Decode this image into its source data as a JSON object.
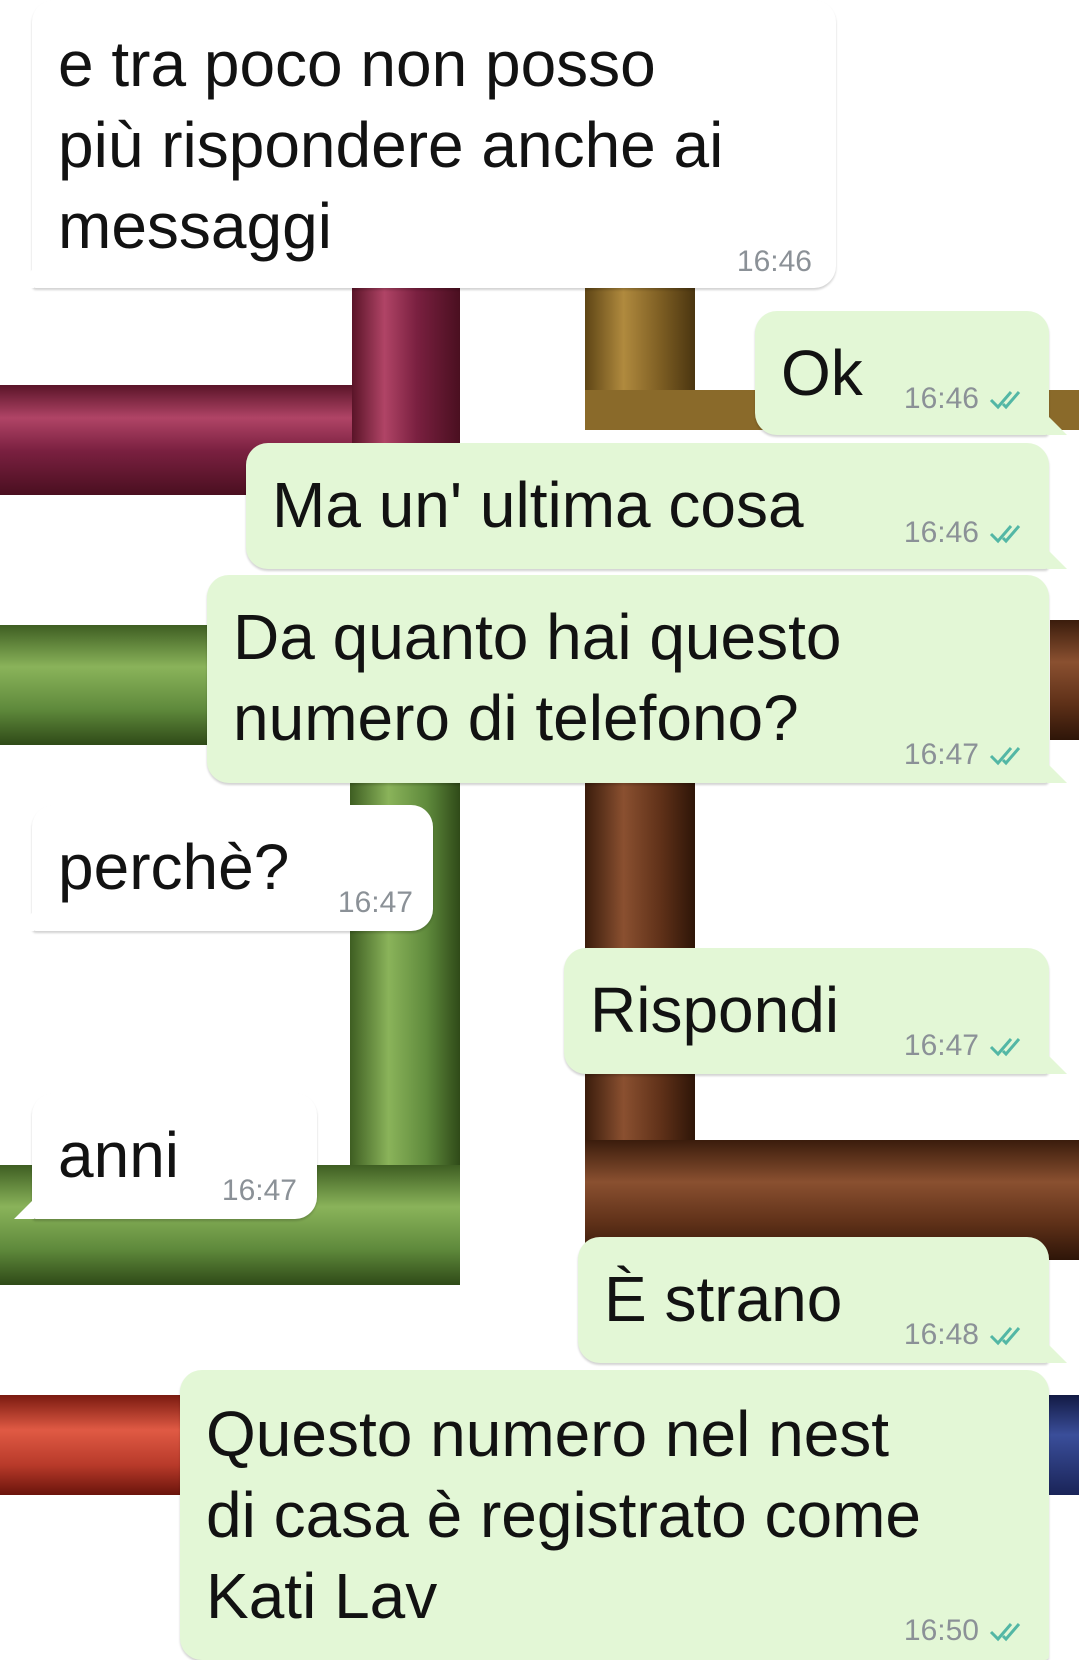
{
  "colors": {
    "incoming_bubble": "#ffffff",
    "outgoing_bubble": "#e3f7d6",
    "timestamp": "#8b9197",
    "read_ticks": "#53b7a5",
    "wallpaper_frames": [
      "#8e2b4b",
      "#8a6a2a",
      "#5f8a3c",
      "#6b3a20",
      "#c23a2c",
      "#2a3a7a"
    ]
  },
  "wallpaper": {
    "description_icon": "decorative-frames-wallpaper"
  },
  "messages": [
    {
      "id": "m1",
      "direction": "incoming",
      "text": "e tra poco non posso\npiù rispondere anche ai\nmessaggi",
      "time": "16:46"
    },
    {
      "id": "m2",
      "direction": "outgoing",
      "text": "Ok",
      "time": "16:46",
      "status_icon": "double-check-icon"
    },
    {
      "id": "m3",
      "direction": "outgoing",
      "text": "Ma un' ultima cosa",
      "time": "16:46",
      "status_icon": "double-check-icon"
    },
    {
      "id": "m4",
      "direction": "outgoing",
      "text": "Da quanto hai questo\nnumero di telefono?",
      "time": "16:47",
      "status_icon": "double-check-icon"
    },
    {
      "id": "m5",
      "direction": "incoming",
      "text": "perchè?",
      "time": "16:47"
    },
    {
      "id": "m6",
      "direction": "outgoing",
      "text": "Rispondi",
      "time": "16:47",
      "status_icon": "double-check-icon"
    },
    {
      "id": "m7",
      "direction": "incoming",
      "text": "anni",
      "time": "16:47"
    },
    {
      "id": "m8",
      "direction": "outgoing",
      "text": "È strano",
      "time": "16:48",
      "status_icon": "double-check-icon"
    },
    {
      "id": "m9",
      "direction": "outgoing",
      "text": "Questo numero nel nest\ndi casa è registrato come\nKati Lav",
      "time": "16:50",
      "status_icon": "double-check-icon"
    }
  ]
}
